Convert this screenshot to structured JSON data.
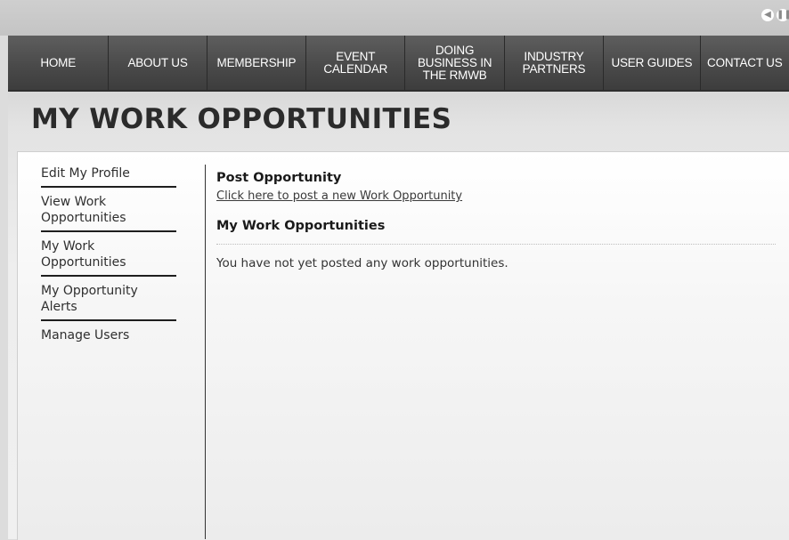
{
  "window": {
    "controls": [
      "back-icon",
      "pause-icon"
    ]
  },
  "nav": {
    "items": [
      {
        "label": "HOME"
      },
      {
        "label": "ABOUT US"
      },
      {
        "label": "MEMBERSHIP"
      },
      {
        "label": "EVENT\nCALENDAR"
      },
      {
        "label": "DOING\nBUSINESS IN\nTHE RMWB"
      },
      {
        "label": "INDUSTRY\nPARTNERS"
      },
      {
        "label": "USER GUIDES"
      },
      {
        "label": "CONTACT US"
      }
    ]
  },
  "page": {
    "title": "MY WORK OPPORTUNITIES"
  },
  "sidebar": {
    "items": [
      {
        "label": "Edit My Profile"
      },
      {
        "label": "View Work Opportunities"
      },
      {
        "label": "My Work Opportunities"
      },
      {
        "label": "My Opportunity Alerts"
      },
      {
        "label": "Manage Users"
      }
    ]
  },
  "main": {
    "post_heading": "Post Opportunity",
    "post_link": "Click here to post a new Work Opportunity",
    "section_heading": "My Work Opportunities",
    "empty_message": "You have not yet posted any work opportunities."
  },
  "colors": {
    "nav_background": "#4a4a4a",
    "nav_text": "#ffffff",
    "title_text": "#2b2b2b"
  }
}
